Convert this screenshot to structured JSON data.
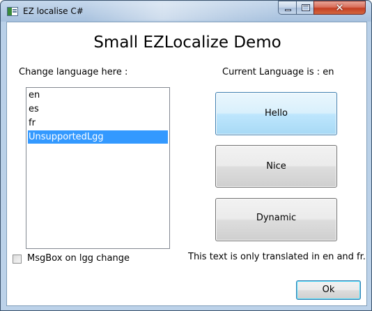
{
  "window": {
    "title": "EZ localise C#",
    "close_glyph": "✕"
  },
  "main": {
    "heading": "Small EZLocalize Demo",
    "change_language_label": "Change language here :",
    "current_language_label": "Current Language is :  en",
    "languages": [
      "en",
      "es",
      "fr",
      "UnsupportedLgg"
    ],
    "selected_language": "UnsupportedLgg",
    "buttons": {
      "hello": "Hello",
      "nice": "Nice",
      "dynamic": "Dynamic",
      "ok": "Ok"
    },
    "translation_note": "This text is only translated in en and fr.",
    "msgbox_checkbox_label": "MsgBox on lgg change",
    "msgbox_checked": false
  },
  "colors": {
    "selection": "#3399ff",
    "hot_button": "#bee6fd",
    "close_button": "#c43f24"
  },
  "icons": {
    "app": "window-app-icon",
    "minimize": "minimize-icon",
    "maximize": "maximize-icon",
    "close": "close-icon"
  }
}
